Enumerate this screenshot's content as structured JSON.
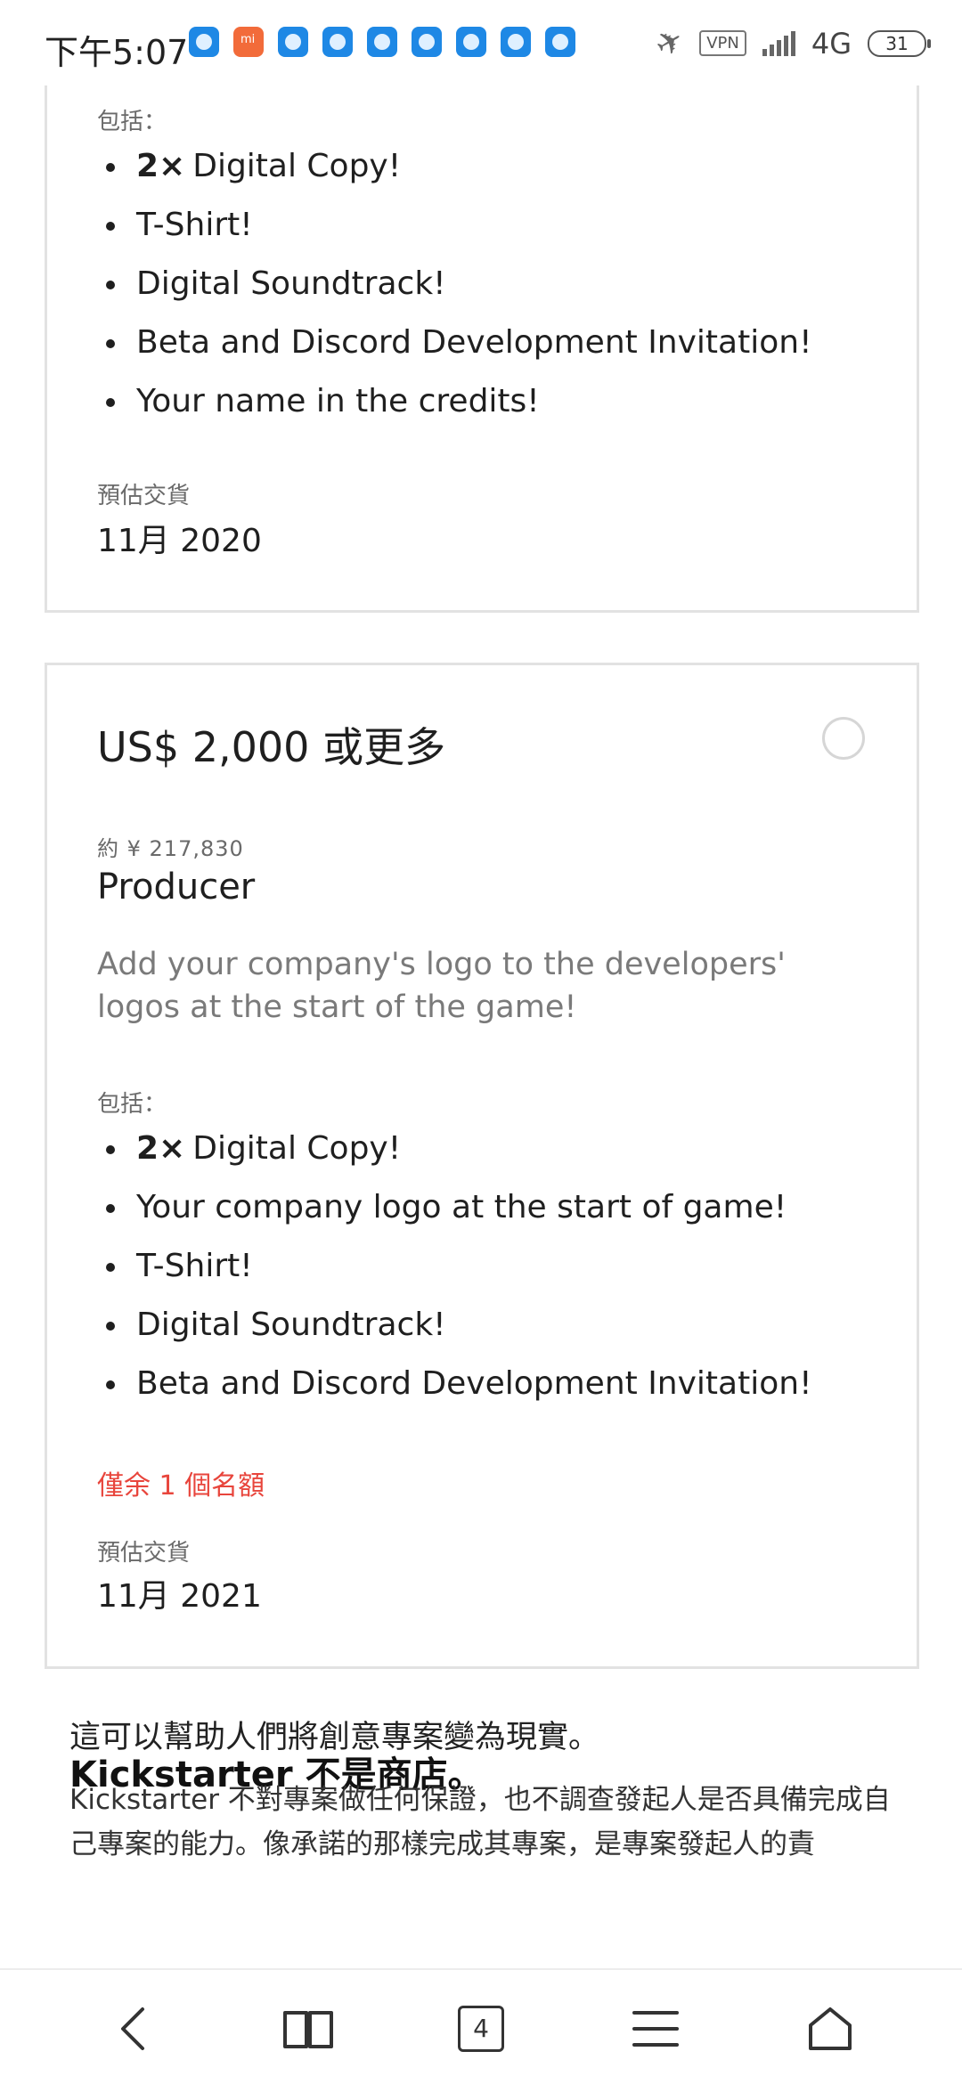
{
  "status_bar": {
    "time": "下午5:07",
    "vpn": "VPN",
    "network": "4G",
    "battery": "31"
  },
  "reward_prev": {
    "includes_label": "包括：",
    "items": [
      {
        "qty": "2×",
        "text": "Digital Copy!"
      },
      {
        "qty": "",
        "text": "T-Shirt!"
      },
      {
        "qty": "",
        "text": "Digital Soundtrack!"
      },
      {
        "qty": "",
        "text": "Beta and Discord Development Invitation!"
      },
      {
        "qty": "",
        "text": "Your name in the credits!"
      }
    ],
    "delivery_label": "預估交貨",
    "delivery_date": "11月 2020"
  },
  "reward_producer": {
    "price": "US$ 2,000 或更多",
    "approx": "約 ¥ 217,830",
    "title": "Producer",
    "description": "Add your company's logo to the developers' logos at the start of the game!",
    "includes_label": "包括：",
    "items": [
      {
        "qty": "2×",
        "text": "Digital Copy!"
      },
      {
        "qty": "",
        "text": "Your company logo at the start of game!"
      },
      {
        "qty": "",
        "text": "T-Shirt!"
      },
      {
        "qty": "",
        "text": "Digital Soundtrack!"
      },
      {
        "qty": "",
        "text": "Beta and Discord Development Invitation!"
      }
    ],
    "remaining": "僅余 1 個名額",
    "delivery_label": "預估交貨",
    "delivery_date": "11月 2021"
  },
  "kickstarter_note": {
    "heading": "Kickstarter 不是商店。",
    "subheading": "這可以幫助人們將創意專案變為現實。",
    "body": "Kickstarter 不對專案做任何保證，也不調查發起人是否具備完成自己專案的能力。像承諾的那樣完成其專案，是專案發起人的責"
  },
  "bottom_nav": {
    "tab_count": "4"
  },
  "colors": {
    "accent_remaining": "#e8453c",
    "card_border": "#e2e2e2"
  }
}
